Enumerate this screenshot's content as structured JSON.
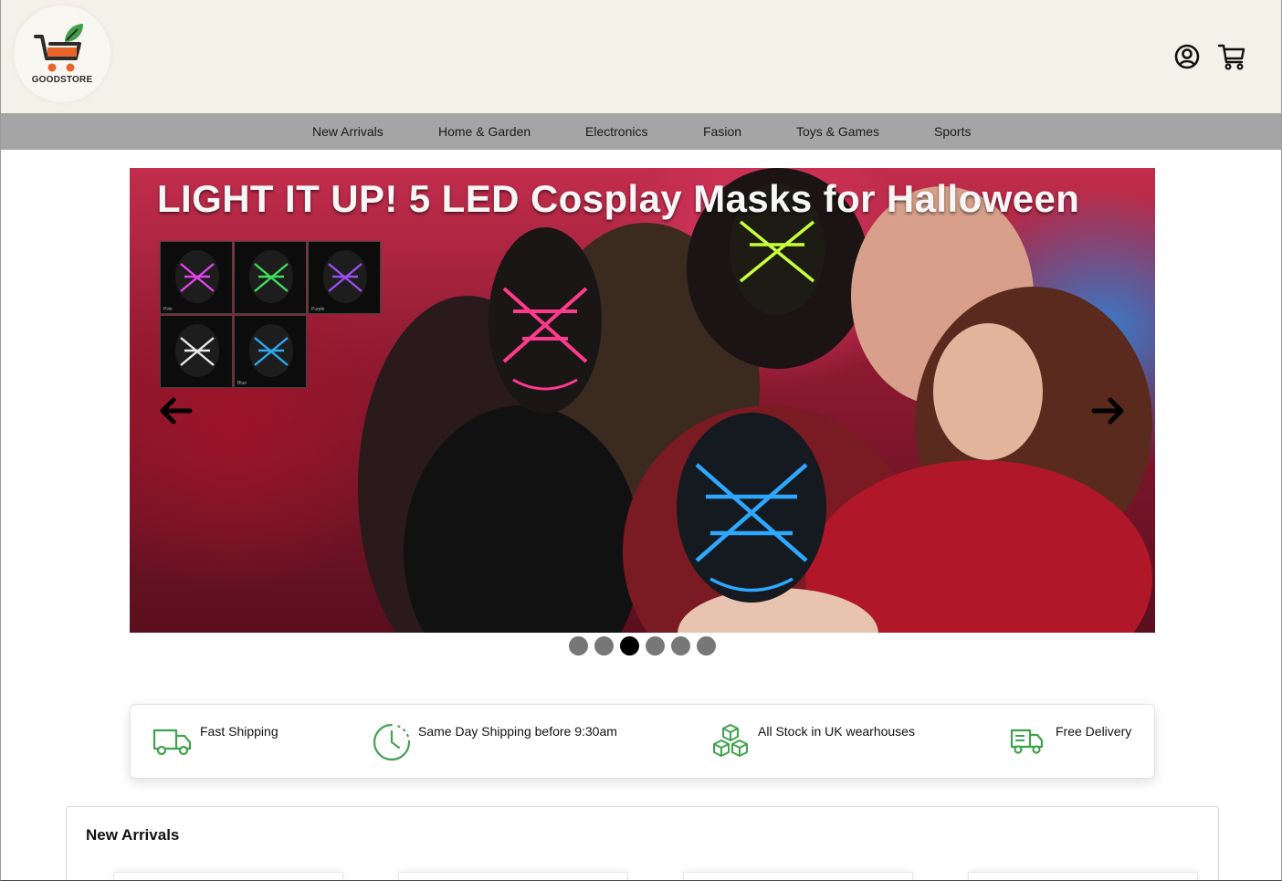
{
  "brand": {
    "name": "GOODSTORE"
  },
  "header": {
    "account_icon": "user-circle-icon",
    "cart_icon": "shopping-cart-icon"
  },
  "nav": {
    "items": [
      {
        "label": "New Arrivals"
      },
      {
        "label": "Home & Garden"
      },
      {
        "label": "Electronics"
      },
      {
        "label": "Fasion"
      },
      {
        "label": "Toys & Games"
      },
      {
        "label": "Sports"
      }
    ]
  },
  "hero": {
    "title": "LIGHT IT UP! 5 LED Cosplay Masks for Halloween",
    "thumbnails": [
      {
        "label": "Pink",
        "color": "#e046e8"
      },
      {
        "label": "",
        "color": "#3ee05a"
      },
      {
        "label": "Purple",
        "color": "#9a4ff0"
      },
      {
        "label": "",
        "color": "#e8e8e8"
      },
      {
        "label": "Blue",
        "color": "#2fa8f0"
      }
    ],
    "prev_icon": "arrow-left-icon",
    "next_icon": "arrow-right-icon",
    "slide_count": 6,
    "active_slide": 3
  },
  "features": [
    {
      "icon": "truck-icon",
      "label": "Fast Shipping"
    },
    {
      "icon": "clock-icon",
      "label": "Same Day Shipping before 9:30am"
    },
    {
      "icon": "boxes-icon",
      "label": "All Stock in UK wearhouses"
    },
    {
      "icon": "delivery-truck-icon",
      "label": "Free Delivery"
    }
  ],
  "colors": {
    "header_bg": "#f4f1e8",
    "nav_bg": "#a5a5a5",
    "feature_icon": "#3fa34d",
    "logo_orange": "#e8642a",
    "logo_green": "#3f9e47"
  },
  "new_arrivals": {
    "title": "New Arrivals"
  }
}
